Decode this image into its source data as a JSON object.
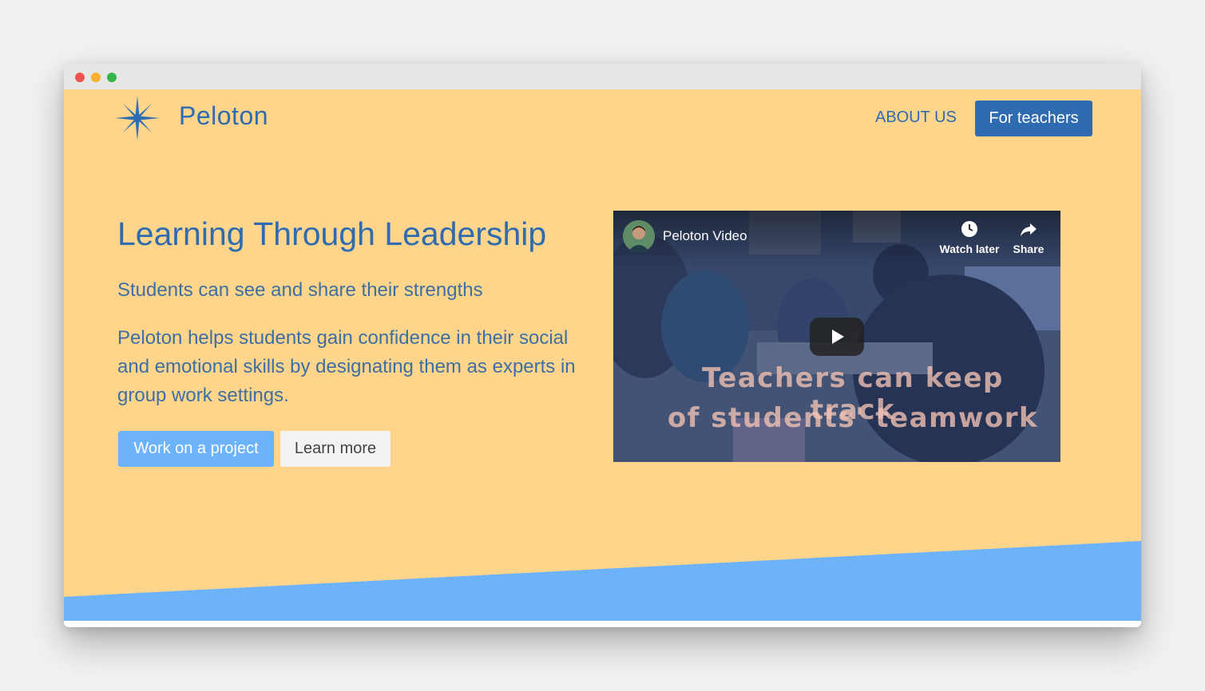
{
  "colors": {
    "page_background": "#fed58a",
    "brand_blue": "#2f6bb0",
    "primary_button": "#6db3fc",
    "accent_wedge": "#6db3fc",
    "nav_button": "#2f6bb0",
    "window_dot_red": "#ef5350",
    "window_dot_yellow": "#f6b02e",
    "window_dot_green": "#35b748"
  },
  "header": {
    "brand": "Peloton",
    "logo_icon": "star-icon",
    "nav_about": "ABOUT US",
    "nav_teachers": "For teachers"
  },
  "hero": {
    "headline": "Learning Through Leadership",
    "subheadline": "Students can see and share their strengths",
    "body": "Peloton helps students gain confidence in their social and emotional skills by designating them as experts in group work settings.",
    "primary_button": "Work on a project",
    "secondary_button": "Learn more"
  },
  "video": {
    "title": "Peloton Video",
    "watch_later": "Watch later",
    "share": "Share",
    "caption_line1": "Teachers can keep track",
    "caption_line2": "of students' teamwork",
    "play_icon": "play-icon",
    "watch_later_icon": "clock-icon",
    "share_icon": "share-arrow-icon"
  }
}
